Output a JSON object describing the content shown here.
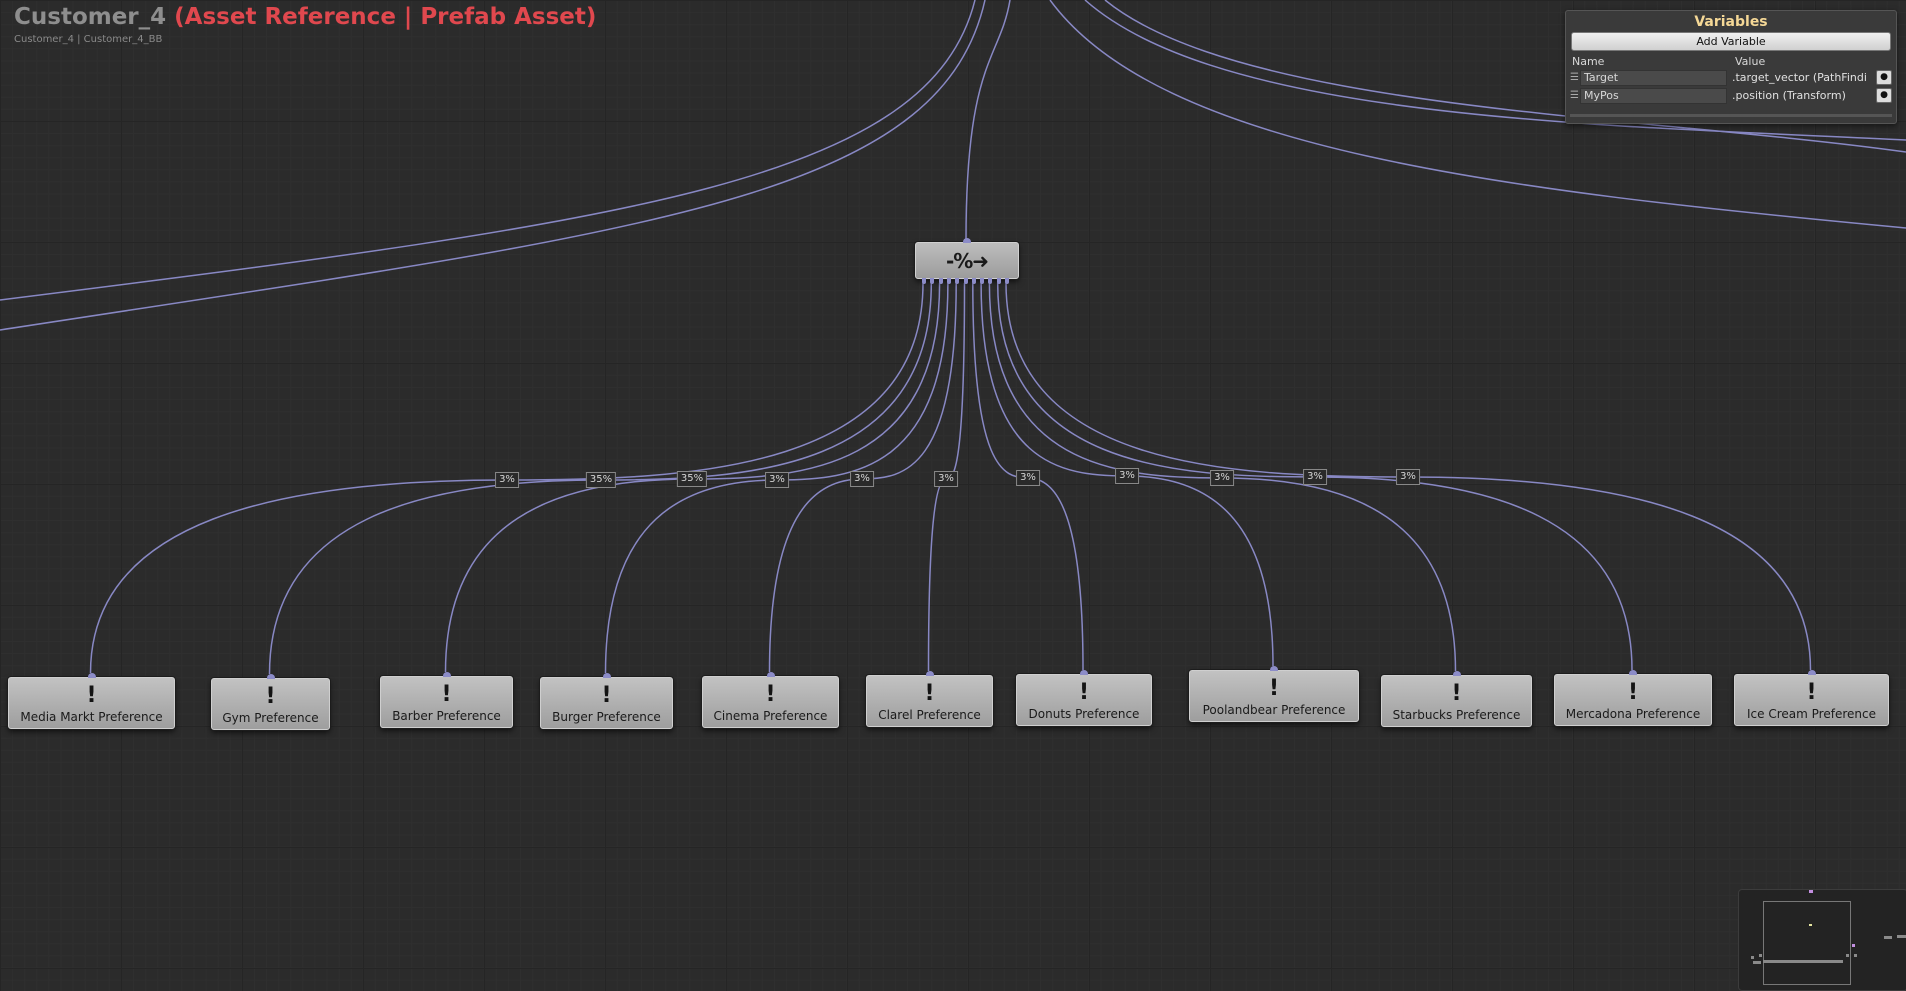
{
  "header": {
    "graph_name": "Customer_4",
    "asset_tag": "(Asset Reference | Prefab Asset)",
    "breadcrumb": "Customer_4 | Customer_4_BB"
  },
  "variables_panel": {
    "title": "Variables",
    "add_button": "Add Variable",
    "col_name": "Name",
    "col_value": "Value",
    "rows": [
      {
        "name": "Target",
        "value": ".target_vector (PathFindi"
      },
      {
        "name": "MyPos",
        "value": ".position (Transform)"
      }
    ]
  },
  "root_node": {
    "glyph": "-%➜"
  },
  "leaf_nodes": [
    {
      "label": "Media Markt Preference",
      "weight": "3%"
    },
    {
      "label": "Gym Preference",
      "weight": "35%"
    },
    {
      "label": "Barber Preference",
      "weight": "35%"
    },
    {
      "label": "Burger Preference",
      "weight": "3%"
    },
    {
      "label": "Cinema Preference",
      "weight": "3%"
    },
    {
      "label": "Clarel Preference",
      "weight": "3%"
    },
    {
      "label": "Donuts Preference",
      "weight": "3%"
    },
    {
      "label": "Poolandbear Preference",
      "weight": "3%"
    },
    {
      "label": "Starbucks Preference",
      "weight": "3%"
    },
    {
      "label": "Mercadona Preference",
      "weight": "3%"
    },
    {
      "label": "Ice Cream Preference",
      "weight": "3%"
    }
  ],
  "colors": {
    "wire": "#8c8cc8",
    "title_tag": "#e0484e",
    "variables_title": "#f5d896"
  }
}
